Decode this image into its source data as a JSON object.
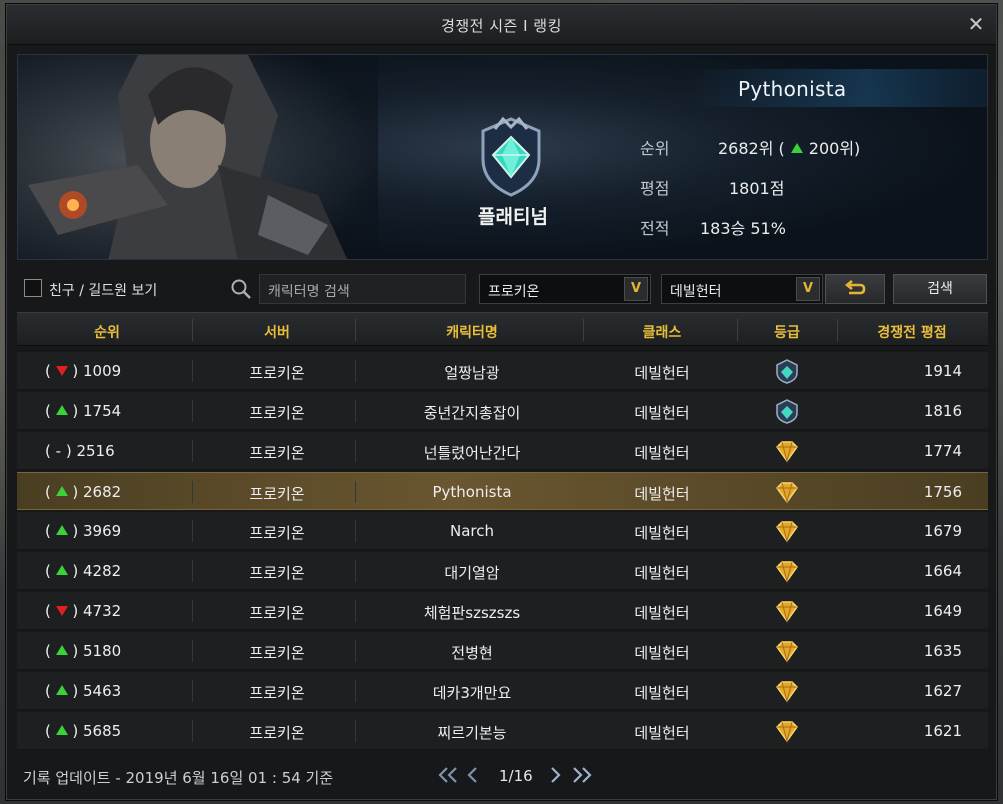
{
  "window": {
    "title": "경쟁전 시즌 Ⅰ 랭킹",
    "close_label": "✕"
  },
  "player": {
    "name": "Pythonista",
    "tier": "플래티넘",
    "rank_label": "순위",
    "rank_value": "2682위 (",
    "rank_change": "200위)",
    "score_label": "평점",
    "score_value": "1801점",
    "record_label": "전적",
    "record_value": "183승 51%"
  },
  "filters": {
    "friends_checkbox_label": "친구 / 길드원 보기",
    "search_placeholder": "캐릭터명 검색",
    "server_select": "프로키온",
    "class_select": "데빌헌터",
    "reset_label": "⮌",
    "search_label": "검색"
  },
  "table": {
    "headers": [
      "순위",
      "서버",
      "캐릭터명",
      "클래스",
      "등급",
      "경쟁전 평점"
    ],
    "rows": [
      {
        "trend": "down",
        "rank": "1009",
        "server": "프로키온",
        "name": "얼짱남광",
        "class": "데빌헌터",
        "grade": "platinum",
        "score": "1914"
      },
      {
        "trend": "up",
        "rank": "1754",
        "server": "프로키온",
        "name": "중년간지총잡이",
        "class": "데빌헌터",
        "grade": "platinum",
        "score": "1816"
      },
      {
        "trend": "same",
        "rank": "2516",
        "server": "프로키온",
        "name": "넌틀렸어난간다",
        "class": "데빌헌터",
        "grade": "gold",
        "score": "1774"
      },
      {
        "trend": "up",
        "rank": "2682",
        "server": "프로키온",
        "name": "Pythonista",
        "class": "데빌헌터",
        "grade": "gold",
        "score": "1756",
        "highlight": true
      },
      {
        "trend": "up",
        "rank": "3969",
        "server": "프로키온",
        "name": "Narch",
        "class": "데빌헌터",
        "grade": "gold",
        "score": "1679"
      },
      {
        "trend": "up",
        "rank": "4282",
        "server": "프로키온",
        "name": "대기열암",
        "class": "데빌헌터",
        "grade": "gold",
        "score": "1664"
      },
      {
        "trend": "down",
        "rank": "4732",
        "server": "프로키온",
        "name": "체험판szszszs",
        "class": "데빌헌터",
        "grade": "gold",
        "score": "1649"
      },
      {
        "trend": "up",
        "rank": "5180",
        "server": "프로키온",
        "name": "전병현",
        "class": "데빌헌터",
        "grade": "gold",
        "score": "1635"
      },
      {
        "trend": "up",
        "rank": "5463",
        "server": "프로키온",
        "name": "데카3개만요",
        "class": "데빌헌터",
        "grade": "gold",
        "score": "1627"
      },
      {
        "trend": "up",
        "rank": "5685",
        "server": "프로키온",
        "name": "찌르기본능",
        "class": "데빌헌터",
        "grade": "gold",
        "score": "1621"
      }
    ]
  },
  "footer": {
    "update_text": "기록 업데이트 - 2019년 6월 16일 01 : 54 기준",
    "page_text": "1/16"
  },
  "colors": {
    "accent_gold": "#e8be3a",
    "trend_up": "#3ad13a",
    "trend_down": "#e02020",
    "highlight_row": "#6a5630"
  },
  "icons": {
    "close": "close-icon",
    "search": "search-icon",
    "reset": "reset-icon",
    "first_page": "double-chevron-left-icon",
    "prev_page": "chevron-left-icon",
    "next_page": "chevron-right-icon",
    "last_page": "double-chevron-right-icon"
  }
}
